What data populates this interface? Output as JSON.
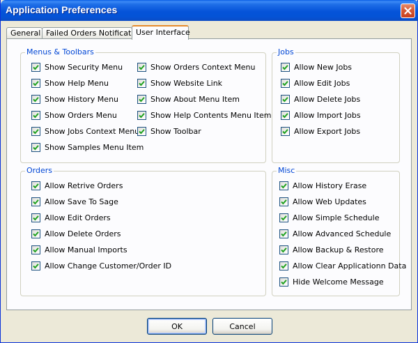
{
  "window": {
    "title": "Application Preferences"
  },
  "tabs": [
    {
      "label": "General",
      "active": false
    },
    {
      "label": "Failed Orders Notification",
      "active": false
    },
    {
      "label": "User Interface",
      "active": true
    }
  ],
  "groups": {
    "menus_toolbars": {
      "title": "Menus & Toolbars",
      "col1": [
        {
          "label": "Show Security Menu",
          "checked": true
        },
        {
          "label": "Show Help Menu",
          "checked": true
        },
        {
          "label": "Show History Menu",
          "checked": true
        },
        {
          "label": "Show Orders Menu",
          "checked": true
        },
        {
          "label": "Show Jobs Context Menu",
          "checked": true
        },
        {
          "label": "Show Samples Menu Item",
          "checked": true
        }
      ],
      "col2": [
        {
          "label": "Show Orders Context Menu",
          "checked": true
        },
        {
          "label": "Show Website Link",
          "checked": true
        },
        {
          "label": "Show About Menu Item",
          "checked": true
        },
        {
          "label": "Show Help Contents Menu Item",
          "checked": true
        },
        {
          "label": "Show Toolbar",
          "checked": true
        }
      ]
    },
    "jobs": {
      "title": "Jobs",
      "items": [
        {
          "label": "Allow New Jobs",
          "checked": true
        },
        {
          "label": "Allow Edit Jobs",
          "checked": true
        },
        {
          "label": "Allow Delete Jobs",
          "checked": true
        },
        {
          "label": "Allow Import Jobs",
          "checked": true
        },
        {
          "label": "Allow Export Jobs",
          "checked": true
        }
      ]
    },
    "orders": {
      "title": "Orders",
      "items": [
        {
          "label": "Allow Retrive Orders",
          "checked": true
        },
        {
          "label": "Allow Save To Sage",
          "checked": true
        },
        {
          "label": "Allow Edit Orders",
          "checked": true
        },
        {
          "label": "Allow Delete Orders",
          "checked": true
        },
        {
          "label": "Allow Manual Imports",
          "checked": true
        },
        {
          "label": "Allow Change Customer/Order ID",
          "checked": true
        }
      ]
    },
    "misc": {
      "title": "Misc",
      "items": [
        {
          "label": "Allow History Erase",
          "checked": true
        },
        {
          "label": "Allow Web Updates",
          "checked": true
        },
        {
          "label": "Allow Simple Schedule",
          "checked": true
        },
        {
          "label": "Allow Advanced Schedule",
          "checked": true
        },
        {
          "label": "Allow Backup & Restore",
          "checked": true
        },
        {
          "label": "Allow Clear Applicationn Data",
          "checked": true
        },
        {
          "label": "Hide Welcome Message",
          "checked": true
        }
      ]
    }
  },
  "buttons": {
    "ok": "OK",
    "cancel": "Cancel"
  },
  "colors": {
    "title_bar": "#0553d9",
    "group_title": "#0046d5",
    "check_mark": "#21a121",
    "active_tab_accent": "#e68b2c"
  }
}
